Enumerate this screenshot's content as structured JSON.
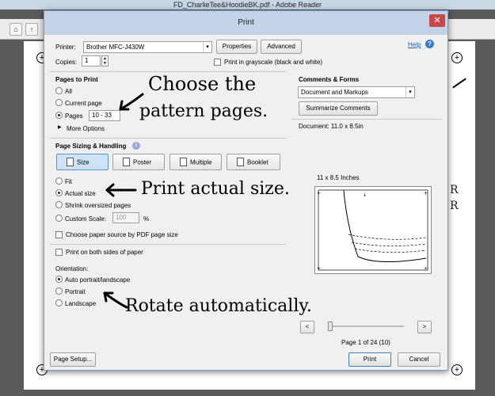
{
  "app": {
    "title": "FD_CharlieTee&HoodieBK.pdf - Adobe Reader",
    "side_text_1": "R",
    "side_text_2": "R"
  },
  "dialog": {
    "title": "Print",
    "close_glyph": "✕"
  },
  "printer": {
    "label": "Printer:",
    "value": "Brother MFC-J430W",
    "properties_label": "Properties",
    "advanced_label": "Advanced",
    "help_label": "Help",
    "copies_label": "Copies:",
    "copies_value": "1",
    "grayscale_label": "Print in grayscale (black and white)"
  },
  "pages_to_print": {
    "heading": "Pages to Print",
    "all_label": "All",
    "current_label": "Current page",
    "pages_label": "Pages",
    "pages_value": "10 - 33",
    "more_options_label": "More Options",
    "selected": "Pages"
  },
  "sizing": {
    "heading": "Page Sizing & Handling",
    "tabs": [
      {
        "label": "Size",
        "icon": "size-icon"
      },
      {
        "label": "Poster",
        "icon": "poster-icon"
      },
      {
        "label": "Multiple",
        "icon": "multiple-icon"
      },
      {
        "label": "Booklet",
        "icon": "booklet-icon"
      }
    ],
    "active_tab": "Size",
    "fit_label": "Fit",
    "actual_label": "Actual size",
    "shrink_label": "Shrink oversized pages",
    "custom_label": "Custom Scale:",
    "custom_value": "100",
    "percent": "%",
    "paper_source_label": "Choose paper source by PDF page size",
    "selected": "Actual size"
  },
  "both_sides_label": "Print on both sides of paper",
  "orientation": {
    "heading": "Orientation:",
    "auto_label": "Auto portrait/landscape",
    "portrait_label": "Portrait",
    "landscape_label": "Landscape",
    "selected": "Auto portrait/landscape"
  },
  "comments": {
    "heading": "Comments & Forms",
    "value": "Document and Markups",
    "summarize_label": "Summarize Comments",
    "document_size": "Document: 11.0 x 8.5in",
    "preview_size": "11 x 8.5 Inches",
    "page_indicator": "Page 1 of 24 (10)",
    "prev_glyph": "<",
    "next_glyph": ">"
  },
  "footer": {
    "page_setup_label": "Page Setup...",
    "print_label": "Print",
    "cancel_label": "Cancel"
  },
  "annotations": {
    "choose_line1": "Choose the",
    "choose_line2": "pattern pages.",
    "actual": "Print actual size.",
    "rotate": "Rotate automatically."
  },
  "colors": {
    "dialog_bg": "#f0f0f0",
    "titlebar": "#c2d3e8",
    "close_button": "#c7474a",
    "help_link": "#1a5fb4",
    "active_tab": "#cde3f8"
  }
}
